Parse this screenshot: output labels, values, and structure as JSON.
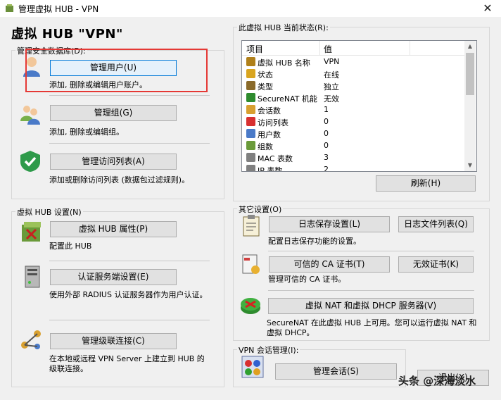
{
  "window": {
    "title": "管理虚拟 HUB - VPN",
    "heading": "虚拟 HUB \"VPN\""
  },
  "security_db": {
    "label": "管理安全数据库(D):",
    "items": [
      {
        "button": "管理用户(U)",
        "desc": "添加, 删除或编辑用户账户。"
      },
      {
        "button": "管理组(G)",
        "desc": "添加, 删除或编辑组。"
      },
      {
        "button": "管理访问列表(A)",
        "desc": "添加或删除访问列表 (数据包过滤规则)。"
      }
    ]
  },
  "hub_settings": {
    "label": "虚拟 HUB 设置(N)",
    "items": [
      {
        "button": "虚拟 HUB 属性(P)",
        "desc": "配置此 HUB"
      },
      {
        "button": "认证服务端设置(E)",
        "desc": "使用外部 RADIUS 认证服务器作为用户认证。"
      },
      {
        "button": "管理级联连接(C)",
        "desc": "在本地或远程 VPN Server 上建立到 HUB 的级联连接。"
      }
    ]
  },
  "status": {
    "label": "此虚拟 HUB 当前状态(R):",
    "col_item": "项目",
    "col_value": "值",
    "rows": [
      {
        "k": "虚拟 HUB 名称",
        "v": "VPN",
        "icon": "hub-icon",
        "color": "#b0801a"
      },
      {
        "k": "状态",
        "v": "在线",
        "icon": "status-icon",
        "color": "#d9a520"
      },
      {
        "k": "类型",
        "v": "独立",
        "icon": "type-icon",
        "color": "#8a6a2a"
      },
      {
        "k": "SecureNAT 机能",
        "v": "无效",
        "icon": "router-icon",
        "color": "#2e8b2e"
      },
      {
        "k": "会话数",
        "v": "1",
        "icon": "session-icon",
        "color": "#d8a030"
      },
      {
        "k": "访问列表",
        "v": "0",
        "icon": "no-entry-icon",
        "color": "#d83030"
      },
      {
        "k": "用户数",
        "v": "0",
        "icon": "user-icon",
        "color": "#4a7ac8"
      },
      {
        "k": "组数",
        "v": "0",
        "icon": "group-icon",
        "color": "#6a9a3a"
      },
      {
        "k": "MAC 表数",
        "v": "3",
        "icon": "gear-icon",
        "color": "#808080"
      },
      {
        "k": "IP 表数",
        "v": "2",
        "icon": "gear-icon",
        "color": "#808080"
      }
    ],
    "refresh": "刷新(H)"
  },
  "other": {
    "label": "其它设置(O)",
    "log_save": "日志保存设置(L)",
    "log_files": "日志文件列表(Q)",
    "log_desc": "配置日志保存功能的设置。",
    "trusted_ca": "可信的 CA 证书(T)",
    "revoked": "无效证书(K)",
    "ca_desc": "管理可信的 CA 证书。",
    "nat_dhcp": "虚拟 NAT 和虚拟 DHCP 服务器(V)",
    "nat_desc": "SecureNAT 在此虚拟 HUB 上可用。您可以运行虚拟 NAT 和虚拟 DHCP。"
  },
  "vpn_sessions": {
    "label": "VPN 会话管理(I):",
    "button": "管理会话(S)"
  },
  "exit_button": "退出(X)",
  "watermark": "头条 @深海淡水"
}
